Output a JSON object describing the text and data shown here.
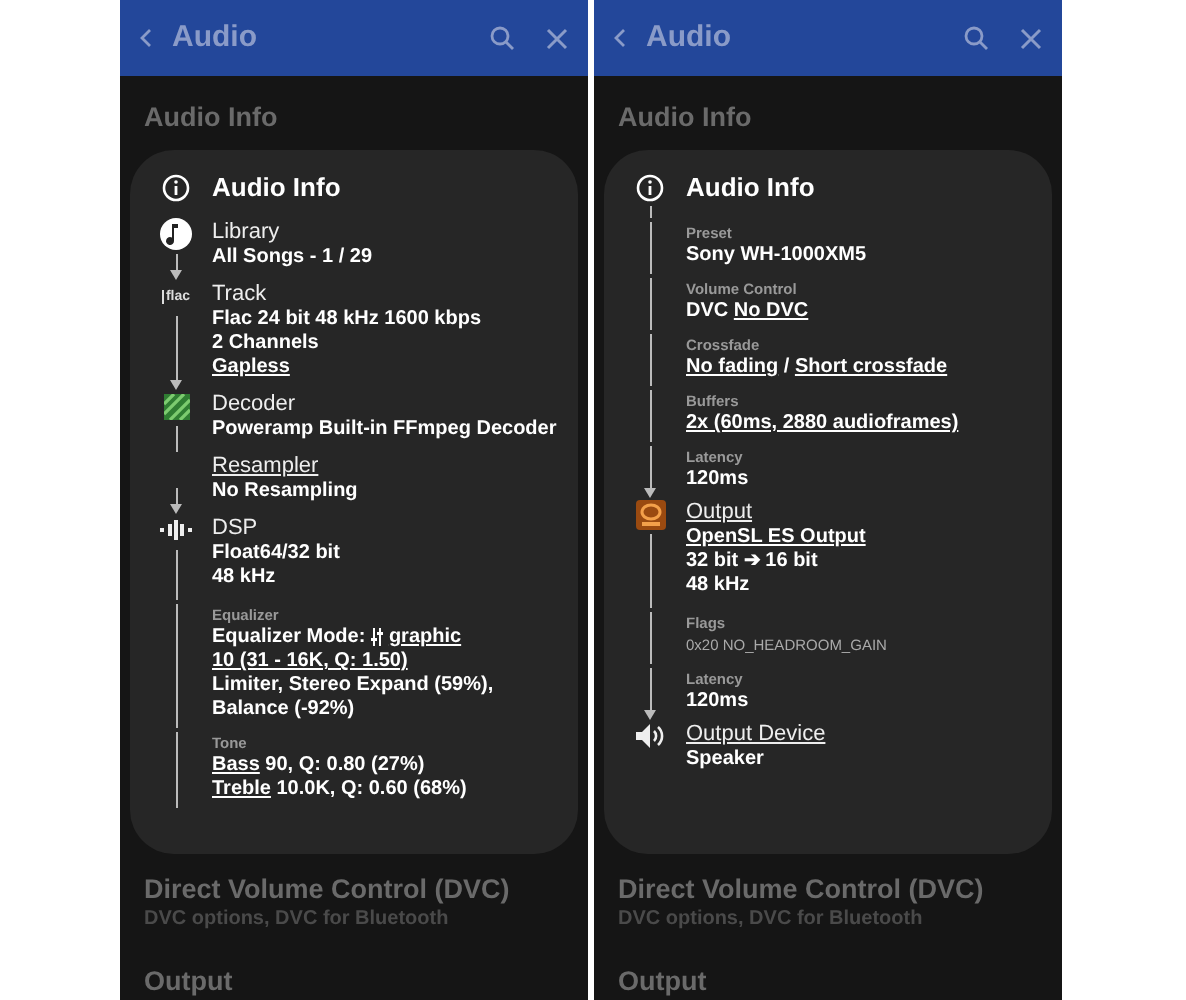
{
  "screens": [
    {
      "header": {
        "title": "Audio"
      },
      "background_sections": [
        {
          "title": "Audio Info"
        },
        {
          "title": "Direct Volume Control (DVC)",
          "subtitle": "DVC options, DVC for Bluetooth"
        },
        {
          "title": "Output"
        }
      ],
      "dialog": {
        "title": "Audio Info",
        "link_down": false,
        "items": [
          {
            "kind": "library",
            "label": "Library",
            "label_link": false,
            "link_down": true,
            "arrow": true,
            "lines": [
              {
                "parts": [
                  {
                    "text": "All Songs - 1 / 29",
                    "link": false
                  }
                ]
              }
            ]
          },
          {
            "kind": "track",
            "badge": "flac",
            "label": "Track",
            "label_link": false,
            "link_down": true,
            "arrow": true,
            "lines": [
              {
                "parts": [
                  {
                    "text": "Flac 24 bit 48 kHz 1600 kbps",
                    "link": false
                  }
                ]
              },
              {
                "parts": [
                  {
                    "text": "2 Channels",
                    "link": false
                  }
                ]
              },
              {
                "parts": [
                  {
                    "text": "Gapless",
                    "link": true
                  }
                ]
              }
            ]
          },
          {
            "kind": "decoder",
            "label": "Decoder",
            "label_link": false,
            "link_down": true,
            "arrow": false,
            "lines": [
              {
                "parts": [
                  {
                    "text": "Poweramp Built-in FFmpeg Decoder",
                    "link": false
                  }
                ]
              }
            ]
          },
          {
            "kind": "stage",
            "label": "Resampler",
            "label_link": true,
            "link_down": true,
            "arrow": true,
            "lines": [
              {
                "parts": [
                  {
                    "text": "No Resampling",
                    "link": false
                  }
                ]
              }
            ]
          },
          {
            "kind": "dsp",
            "label": "DSP",
            "label_link": false,
            "link_down": true,
            "arrow": false,
            "lines": [
              {
                "parts": [
                  {
                    "text": "Float64/32 bit",
                    "link": false
                  }
                ]
              },
              {
                "parts": [
                  {
                    "text": "48 kHz",
                    "link": false
                  }
                ]
              }
            ]
          },
          {
            "kind": "field",
            "label": "Equalizer",
            "link_down": true,
            "arrow": false,
            "lines": [
              {
                "parts": [
                  {
                    "text": "Equalizer Mode: ",
                    "link": false
                  },
                  {
                    "kind": "equalizer",
                    "text": "graphic",
                    "link": true
                  }
                ]
              },
              {
                "parts": [
                  {
                    "text": "10 (31 - 16K, Q: 1.50)",
                    "link": true
                  }
                ]
              },
              {
                "parts": [
                  {
                    "text": "Limiter, Stereo Expand (59%),",
                    "link": false
                  }
                ]
              },
              {
                "parts": [
                  {
                    "text": "Balance (-92%)",
                    "link": false
                  }
                ]
              }
            ]
          },
          {
            "kind": "field",
            "label": "Tone",
            "link_down": true,
            "arrow": false,
            "lines": [
              {
                "parts": [
                  {
                    "text": "Bass",
                    "link": true
                  },
                  {
                    "text": " 90, Q: 0.80 (27%)",
                    "link": false
                  }
                ]
              },
              {
                "parts": [
                  {
                    "text": "Treble",
                    "link": true
                  },
                  {
                    "text": " 10.0K, Q: 0.60 (68%)",
                    "link": false
                  }
                ]
              }
            ]
          }
        ]
      }
    },
    {
      "header": {
        "title": "Audio"
      },
      "background_sections": [
        {
          "title": "Audio Info"
        },
        {
          "title": "Direct Volume Control (DVC)",
          "subtitle": "DVC options, DVC for Bluetooth"
        },
        {
          "title": "Output"
        }
      ],
      "dialog": {
        "title": "Audio Info",
        "link_down": true,
        "items": [
          {
            "kind": "field",
            "label": "Preset",
            "link_down": true,
            "arrow": false,
            "lines": [
              {
                "parts": [
                  {
                    "text": "Sony WH-1000XM5",
                    "link": false
                  }
                ]
              }
            ]
          },
          {
            "kind": "field",
            "label": "Volume Control",
            "link_down": true,
            "arrow": false,
            "lines": [
              {
                "parts": [
                  {
                    "text": "DVC ",
                    "link": false
                  },
                  {
                    "text": "No DVC",
                    "link": true
                  }
                ]
              }
            ]
          },
          {
            "kind": "field",
            "label": "Crossfade",
            "link_down": true,
            "arrow": false,
            "lines": [
              {
                "parts": [
                  {
                    "text": "No fading",
                    "link": true
                  },
                  {
                    "text": " / ",
                    "link": false
                  },
                  {
                    "text": "Short crossfade",
                    "link": true
                  }
                ]
              }
            ]
          },
          {
            "kind": "field",
            "label": "Buffers",
            "link_down": true,
            "arrow": false,
            "lines": [
              {
                "parts": [
                  {
                    "text": "2x (60ms, 2880 audioframes)",
                    "link": true
                  }
                ]
              }
            ]
          },
          {
            "kind": "field",
            "label": "Latency",
            "link_down": true,
            "arrow": true,
            "lines": [
              {
                "parts": [
                  {
                    "text": "120ms",
                    "link": false
                  }
                ]
              }
            ]
          },
          {
            "kind": "output",
            "label": "Output",
            "label_link": true,
            "link_down": true,
            "arrow": false,
            "lines": [
              {
                "parts": [
                  {
                    "text": "OpenSL ES Output",
                    "link": true
                  }
                ]
              },
              {
                "parts": [
                  {
                    "text": "32 bit ➔ 16 bit",
                    "link": false
                  }
                ]
              },
              {
                "parts": [
                  {
                    "text": "48 kHz",
                    "link": false
                  }
                ]
              }
            ]
          },
          {
            "kind": "field",
            "label": "Flags",
            "link_down": true,
            "arrow": false,
            "lines": [
              {
                "small": true,
                "parts": [
                  {
                    "text": "0x20 NO_HEADROOM_GAIN",
                    "link": false
                  }
                ]
              }
            ]
          },
          {
            "kind": "field",
            "label": "Latency",
            "link_down": true,
            "arrow": true,
            "lines": [
              {
                "parts": [
                  {
                    "text": "120ms",
                    "link": false
                  }
                ]
              }
            ]
          },
          {
            "kind": "device",
            "label": "Output Device",
            "label_link": true,
            "link_down": false,
            "arrow": false,
            "lines": [
              {
                "parts": [
                  {
                    "text": "Speaker",
                    "link": false
                  }
                ]
              }
            ]
          }
        ]
      }
    }
  ]
}
